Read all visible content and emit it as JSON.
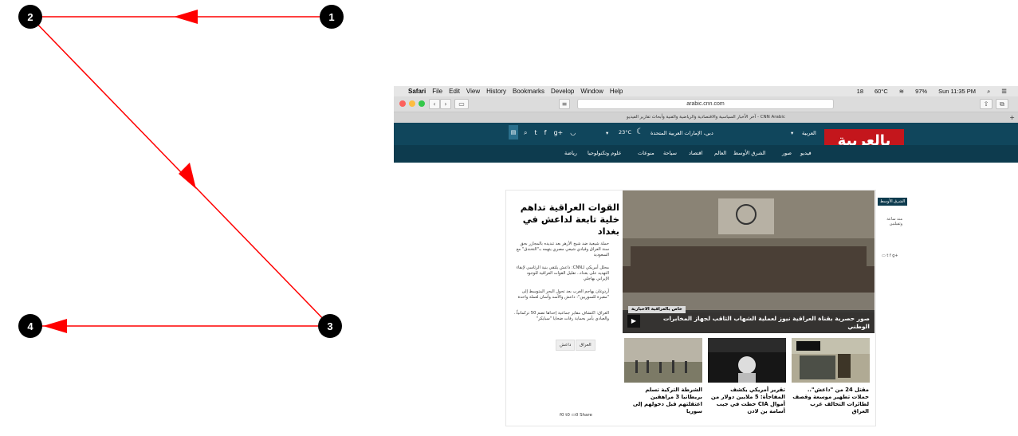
{
  "diagram": {
    "nodes": [
      {
        "id": "1",
        "label": "1"
      },
      {
        "id": "2",
        "label": "2"
      },
      {
        "id": "3",
        "label": "3"
      },
      {
        "id": "4",
        "label": "4"
      }
    ],
    "edges": [
      {
        "from": "1",
        "to": "2"
      },
      {
        "from": "2",
        "to": "3"
      },
      {
        "from": "3",
        "to": "4"
      }
    ],
    "edge_color": "#ff0000",
    "node_color": "#000000"
  },
  "mac_menubar": {
    "apple": "",
    "app": "Safari",
    "items": [
      "File",
      "Edit",
      "View",
      "History",
      "Bookmarks",
      "Develop",
      "Window",
      "Help"
    ],
    "status": [
      "18",
      "60°C",
      "97%",
      "Sun 11:35 PM"
    ]
  },
  "browser": {
    "url": "arabic.cnn.com",
    "tab_title": "آخر الأخبار السياسية والاقتصادية والرياضية والفنية وأبحاث تقارير الفيديو - CNN Arabic"
  },
  "site": {
    "logo": "بالعربية",
    "edition": "العربية",
    "location": "دبي، الإمارات العربية المتحدة",
    "temperature": "23°C",
    "nav": [
      "فيديو",
      "صور",
      "الشرق الأوسط",
      "العالم",
      "اقتصاد",
      "سياحة",
      "منوعات",
      "علوم وتكنولوجيا",
      "رياضة"
    ]
  },
  "article": {
    "headline": "القوات العراقية تداهم خلية تابعة لداعش في بغداد",
    "bullets": [
      "حملة شيعية ضد شيخ الأزهر بعد تنديده بالمجازر بحق سنة العراق وقيادي شيعي مصري يتهمه بـ\"التخندق\" مع السعودية",
      "محلل أمريكي لـCNN: داعش يلتقي بنية الرئاسي لإبقاء التهديد على بغداد.. تقليل القوات العراقية للوجود الإيراني بهاجلي",
      "أردوغان يهاجم الغرب بعد تحول البحر المتوسط إلى \"مقبرة للسوريين\": داعش والأسد وأسان لعملة واحدة",
      "العراق: اكتشاف مقابر جماعية إحداها تضم 50 تركمانياً.. والعبادي يأمر بحماية رفات ضحايا \"سبايكر\""
    ],
    "tags": [
      "العراق",
      "داعش"
    ],
    "share": {
      "facebook": "0",
      "twitter": "0",
      "comments": "0",
      "label": "Share"
    }
  },
  "hero": {
    "badge": "خاص بالعراقية الاخبارية",
    "title": "صور حصرية بقناة العراقية نيوز لعملية الشهاب الثاقب لجهاز المخابرات الوطني"
  },
  "thumbs": [
    {
      "title": "مقتل 24 من \"داعش\".. حملات تطهير موسعة وقصف لطائرات التحالف غرب العراق"
    },
    {
      "title": "تقرير أمريكي يكشف المفاجأة: 5 ملايين دولار من أموال CIA حطت في جيب أسامة بن لادن"
    },
    {
      "title": "الشرطة التركية تسلم بريطانيا 3 مراهقين اعتقلتهم قبل دخولهم إلى سوريا"
    }
  ],
  "sidebar": {
    "tag": "الشرق الأوسط",
    "text": "منذ ساعة وثقيلتين"
  }
}
